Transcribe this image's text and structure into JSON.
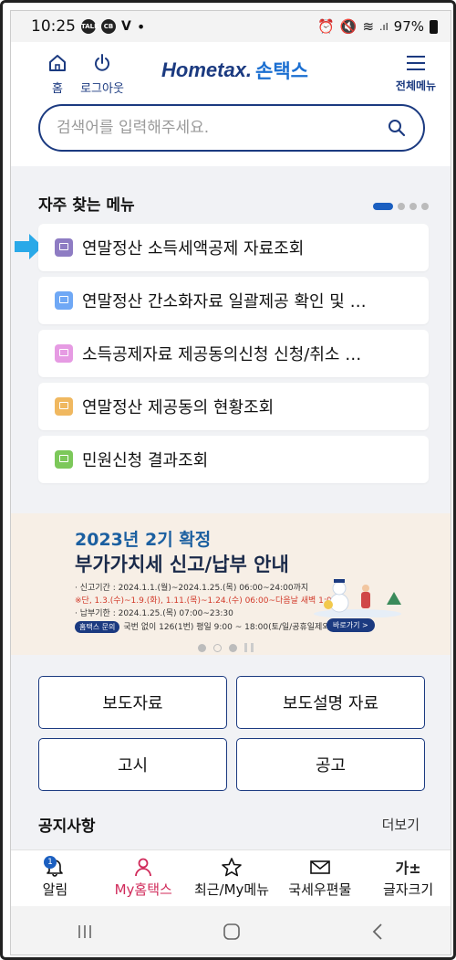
{
  "status_bar": {
    "time": "10:25",
    "battery": "97%"
  },
  "header": {
    "home_label": "홈",
    "logout_label": "로그아웃",
    "logo_main": "Hometax.",
    "logo_sub": "손택스",
    "all_menu_label": "전체메뉴"
  },
  "search": {
    "placeholder": "검색어를 입력해주세요."
  },
  "favorites": {
    "title": "자주 찾는 메뉴",
    "items": [
      {
        "label": "연말정산 소득세액공제 자료조회",
        "color": "#8e7cc3"
      },
      {
        "label": "연말정산 간소화자료 일괄제공 확인 및 …",
        "color": "#6fa8f5"
      },
      {
        "label": "소득공제자료 제공동의신청 신청/취소 …",
        "color": "#e69be3"
      },
      {
        "label": "연말정산 제공동의 현황조회",
        "color": "#f0b860"
      },
      {
        "label": "민원신청 결과조회",
        "color": "#7cc85a"
      }
    ]
  },
  "banner": {
    "headline": "2023년 2기 확정",
    "title": "부가가치세 신고/납부 안내",
    "line1": "· 신고기간 : 2024.1.1.(월)~2024.1.25.(목) 06:00~24:00까지",
    "line2": "※단, 1.3.(수)~1.9.(화), 1.11.(목)~1.24.(수) 06:00~다음날 새벽 1:00",
    "line3": "· 납부기한 : 2024.1.25.(목) 07:00~23:30",
    "tag": "홈택스 문의",
    "line4": "국번 없이 126(1번) 평일 9:00 ~ 18:00(토/일/공휴일제외)",
    "go_label": "바로가기 >"
  },
  "quick_buttons": {
    "press": "보도자료",
    "press_explain": "보도설명 자료",
    "notice_gov": "고시",
    "announce": "공고"
  },
  "notice": {
    "title": "공지사항",
    "more": "더보기"
  },
  "bottom_nav": {
    "alarm": "알림",
    "alarm_badge": "1",
    "my_hometax": "My홈택스",
    "recent": "최근/My메뉴",
    "mail": "국세우편물",
    "font_icon": "가±",
    "font_size": "글자크기"
  },
  "colors": {
    "brand": "#1b3a80",
    "accent": "#1b5fc0",
    "active": "#d02a5a"
  }
}
